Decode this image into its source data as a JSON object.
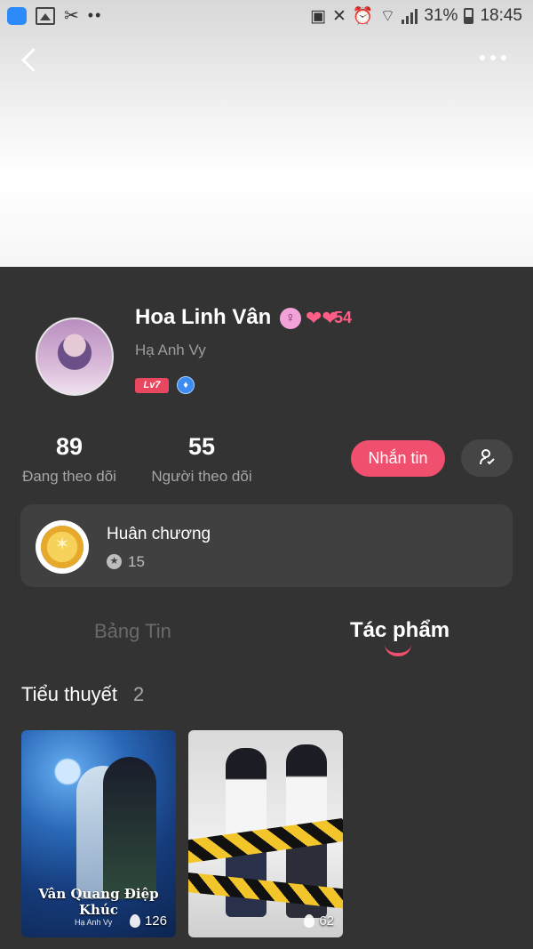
{
  "status_bar": {
    "battery_percent": "31%",
    "time": "18:45"
  },
  "profile": {
    "name": "Hoa Linh Vân",
    "gender_symbol": "♀",
    "hearts_count": "54",
    "pen_name": "Hạ Anh Vy",
    "level": "Lv7",
    "badge_icon": "medal-drop-icon"
  },
  "stats": {
    "following_count": "89",
    "following_label": "Đang theo dõi",
    "followers_count": "55",
    "followers_label": "Người theo dõi"
  },
  "actions": {
    "message_label": "Nhắn tin",
    "follow_icon": "user-check-icon"
  },
  "medals": {
    "title": "Huân chương",
    "count": "15"
  },
  "tabs": [
    {
      "label": "Bảng Tin",
      "active": false
    },
    {
      "label": "Tác phẩm",
      "active": true
    }
  ],
  "section": {
    "title": "Tiểu thuyết",
    "count": "2"
  },
  "books": [
    {
      "title": "Vân Quang Điệp Khúc",
      "author": "Hạ Anh Vy",
      "views": "126"
    },
    {
      "title": "",
      "author": "",
      "views": "62"
    }
  ],
  "colors": {
    "accent": "#f0506e",
    "card_bg": "#333333",
    "panel_bg": "#404040"
  }
}
